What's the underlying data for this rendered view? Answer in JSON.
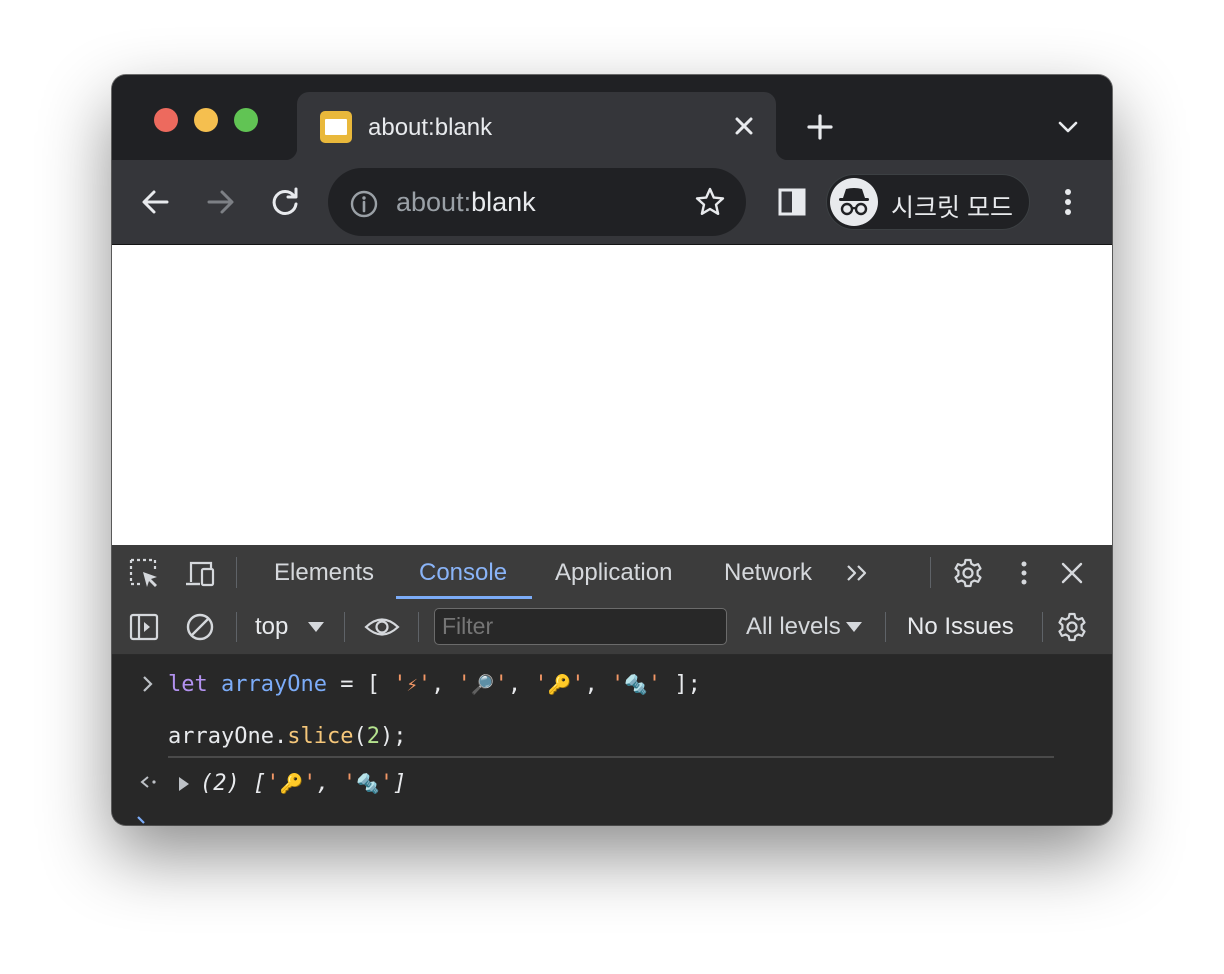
{
  "tab": {
    "title": "about:blank"
  },
  "omnibox": {
    "scheme": "about:",
    "host": "blank"
  },
  "incognito": {
    "label": "시크릿 모드"
  },
  "devtools": {
    "tabs": [
      "Elements",
      "Console",
      "Application",
      "Network"
    ],
    "active_tab": "Console",
    "context": "top",
    "filter_placeholder": "Filter",
    "levels": "All levels",
    "issues": "No Issues"
  },
  "console": {
    "input_line1": {
      "keyword": "let",
      "variable": "arrayOne",
      "rest_open": " = [ ",
      "items": [
        "⚡",
        "🔎",
        "🔑",
        "🔩"
      ],
      "rest_close": " ];"
    },
    "input_line2": {
      "object": "arrayOne",
      "method": "slice",
      "arg": "2",
      "close": ");"
    },
    "result": {
      "count": "(2)",
      "items": [
        "🔑",
        "🔩"
      ]
    }
  },
  "colors": {
    "devtools_accent": "#7cacf8",
    "string": "#f29766",
    "keyword": "#b392f0",
    "number": "#b5e38f",
    "function": "#f6c77a"
  }
}
